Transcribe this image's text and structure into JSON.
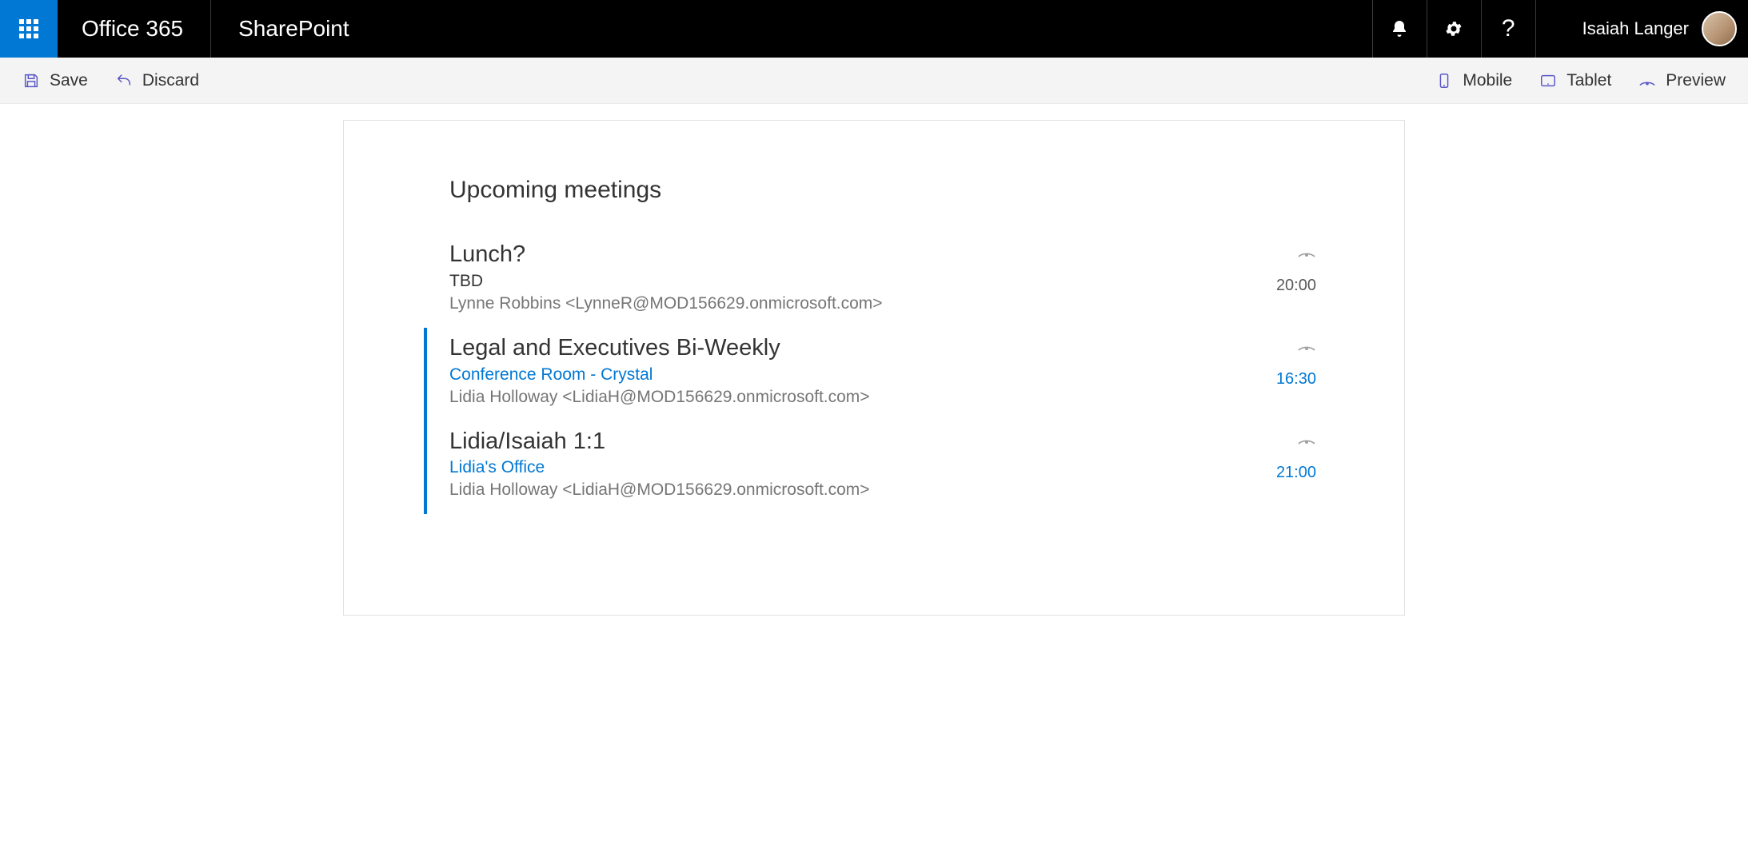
{
  "header": {
    "suite": "Office 365",
    "app": "SharePoint",
    "user_name": "Isaiah Langer"
  },
  "cmdbar": {
    "save": "Save",
    "discard": "Discard",
    "mobile": "Mobile",
    "tablet": "Tablet",
    "preview": "Preview"
  },
  "section": {
    "title": "Upcoming meetings"
  },
  "meetings": [
    {
      "title": "Lunch?",
      "location": "TBD",
      "location_is_link": false,
      "organizer": "Lynne Robbins <LynneR@MOD156629.onmicrosoft.com>",
      "time": "20:00",
      "time_is_link": false,
      "selected": false
    },
    {
      "title": "Legal and Executives Bi-Weekly",
      "location": "Conference Room - Crystal",
      "location_is_link": true,
      "organizer": "Lidia Holloway <LidiaH@MOD156629.onmicrosoft.com>",
      "time": "16:30",
      "time_is_link": true,
      "selected": true
    },
    {
      "title": "Lidia/Isaiah 1:1",
      "location": "Lidia's Office",
      "location_is_link": true,
      "organizer": "Lidia Holloway <LidiaH@MOD156629.onmicrosoft.com>",
      "time": "21:00",
      "time_is_link": true,
      "selected": true
    }
  ]
}
